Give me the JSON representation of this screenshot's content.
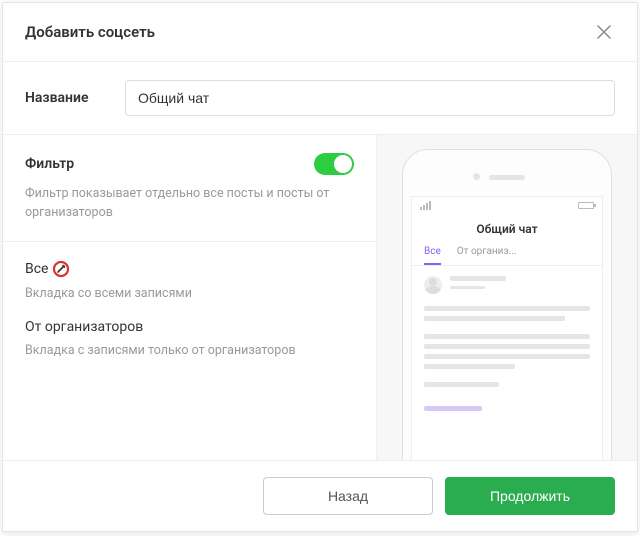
{
  "modal": {
    "title": "Добавить соцсеть"
  },
  "name": {
    "label": "Название",
    "value": "Общий чат"
  },
  "filter": {
    "label": "Фильтр",
    "description": "Фильтр показывает отдельно все посты и посты от организаторов",
    "enabled": true
  },
  "tabs": [
    {
      "title": "Все",
      "description": "Вкладка со всеми записями",
      "editable": true
    },
    {
      "title": "От организаторов",
      "description": "Вкладка с записями только от организаторов",
      "editable": false
    }
  ],
  "preview": {
    "screen_title": "Общий чат",
    "tab_all": "Все",
    "tab_org": "От организ..."
  },
  "footer": {
    "back": "Назад",
    "continue": "Продолжить"
  },
  "colors": {
    "primary_green": "#2aad4f",
    "toggle_green": "#2ecc40",
    "accent_purple": "#8b5cf6"
  }
}
